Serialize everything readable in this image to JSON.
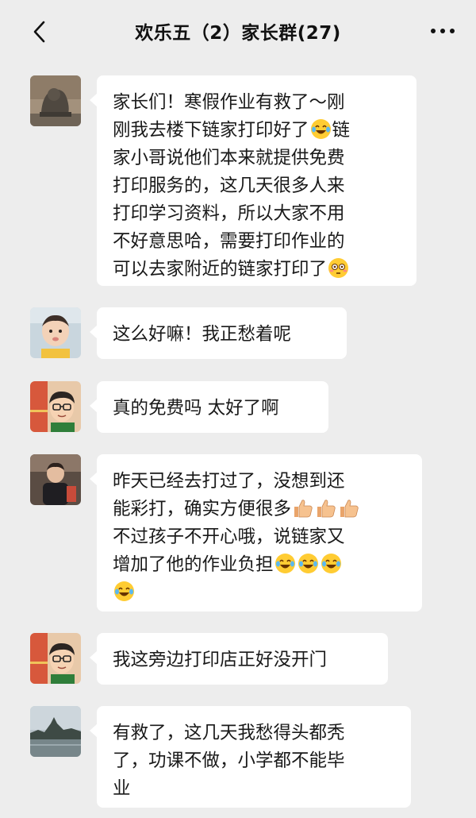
{
  "header": {
    "title": "欢乐五（2）家长群(27)",
    "back_icon": "chevron-left-icon",
    "more_icon": "more-dots-icon"
  },
  "messages": [
    {
      "avatar": "lion-statue-avatar",
      "lines": [
        "家长们！寒假作业有救了～刚",
        "刚我去楼下链家打印好了",
        "家小哥说他们本来就提供免费",
        "打印服务的，这几天很多人来",
        "打印学习资料，所以大家不用",
        "不好意思哈，需要打印作业的",
        "可以去家附近的链家打印了"
      ],
      "line2_tail": "链"
    },
    {
      "avatar": "baby-avatar",
      "text": "这么好嘛！我正愁着呢"
    },
    {
      "avatar": "cartoon-boy-avatar",
      "text": "真的免费吗 太好了啊"
    },
    {
      "avatar": "child-photo-avatar",
      "lines": [
        "昨天已经去打过了，没想到还",
        "能彩打，确实方便很多",
        "不过孩子不开心哦，说链家又",
        "增加了他的作业负担"
      ]
    },
    {
      "avatar": "cartoon-boy-avatar",
      "text": "我这旁边打印店正好没开门"
    },
    {
      "avatar": "landscape-avatar",
      "lines": [
        "有救了，这几天我愁得头都秃",
        "了，功课不做，小学都不能毕",
        "业"
      ]
    }
  ],
  "colors": {
    "background": "#ededed",
    "bubble": "#ffffff",
    "text": "#191919"
  }
}
